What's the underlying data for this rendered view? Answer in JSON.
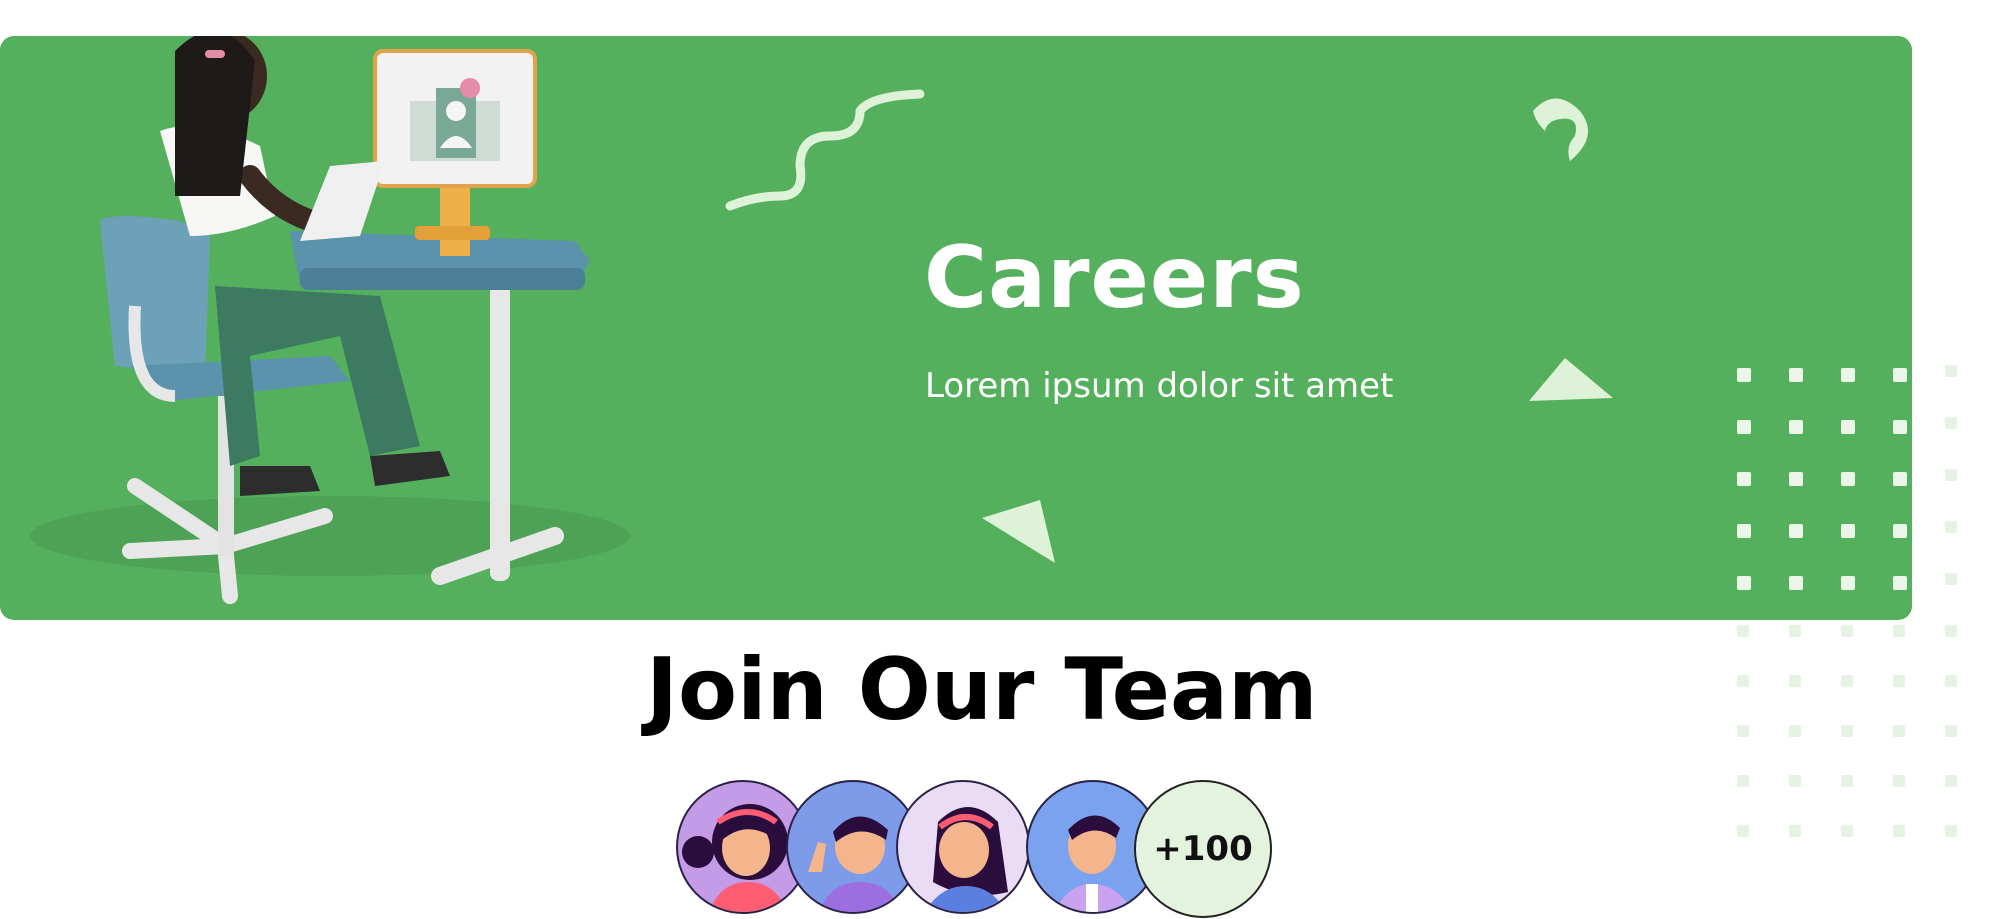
{
  "hero": {
    "title": "Careers",
    "subtitle": "Lorem ipsum dolor sit amet",
    "background_color": "#54b05c",
    "decoration_color": "#def2d8"
  },
  "team": {
    "title": "Join Our Team",
    "member_count_label": "+100",
    "avatars": [
      {
        "icon": "woman-avatar-icon",
        "bg": "#c39be6"
      },
      {
        "icon": "man-waving-avatar-icon",
        "bg": "#7e9bea"
      },
      {
        "icon": "woman-headband-avatar-icon",
        "bg": "#eadcf5"
      },
      {
        "icon": "man-avatar-icon",
        "bg": "#7aa2ee"
      }
    ]
  }
}
